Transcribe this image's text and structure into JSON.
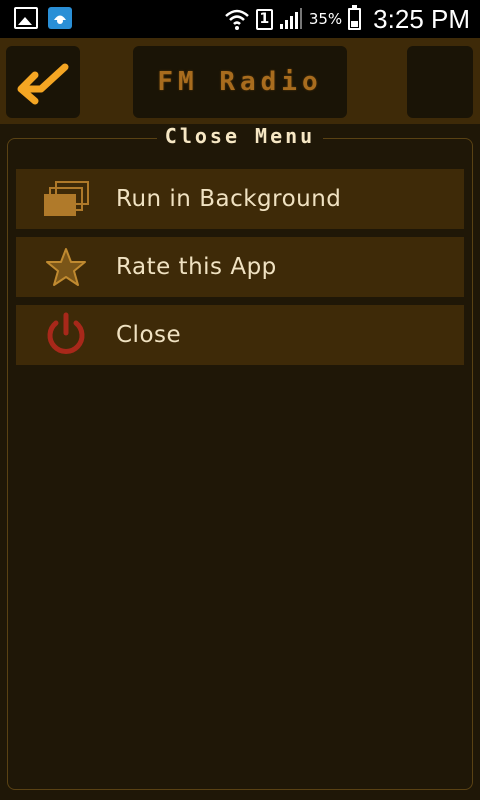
{
  "status_bar": {
    "sim_slot": "1",
    "battery_percent": "35%",
    "time": "3:25 PM"
  },
  "header": {
    "title": "FM Radio",
    "back_icon": "back-arrow-icon"
  },
  "menu": {
    "title": "Close Menu",
    "items": [
      {
        "label": "Run in Background",
        "icon": "windows-stack-icon"
      },
      {
        "label": "Rate this App",
        "icon": "star-icon"
      },
      {
        "label": "Close",
        "icon": "power-icon"
      }
    ]
  },
  "colors": {
    "accent_orange": "#f5a623",
    "header_bg": "#3e2a08",
    "panel_bg": "#1f1707",
    "power_red": "#a8281a"
  }
}
